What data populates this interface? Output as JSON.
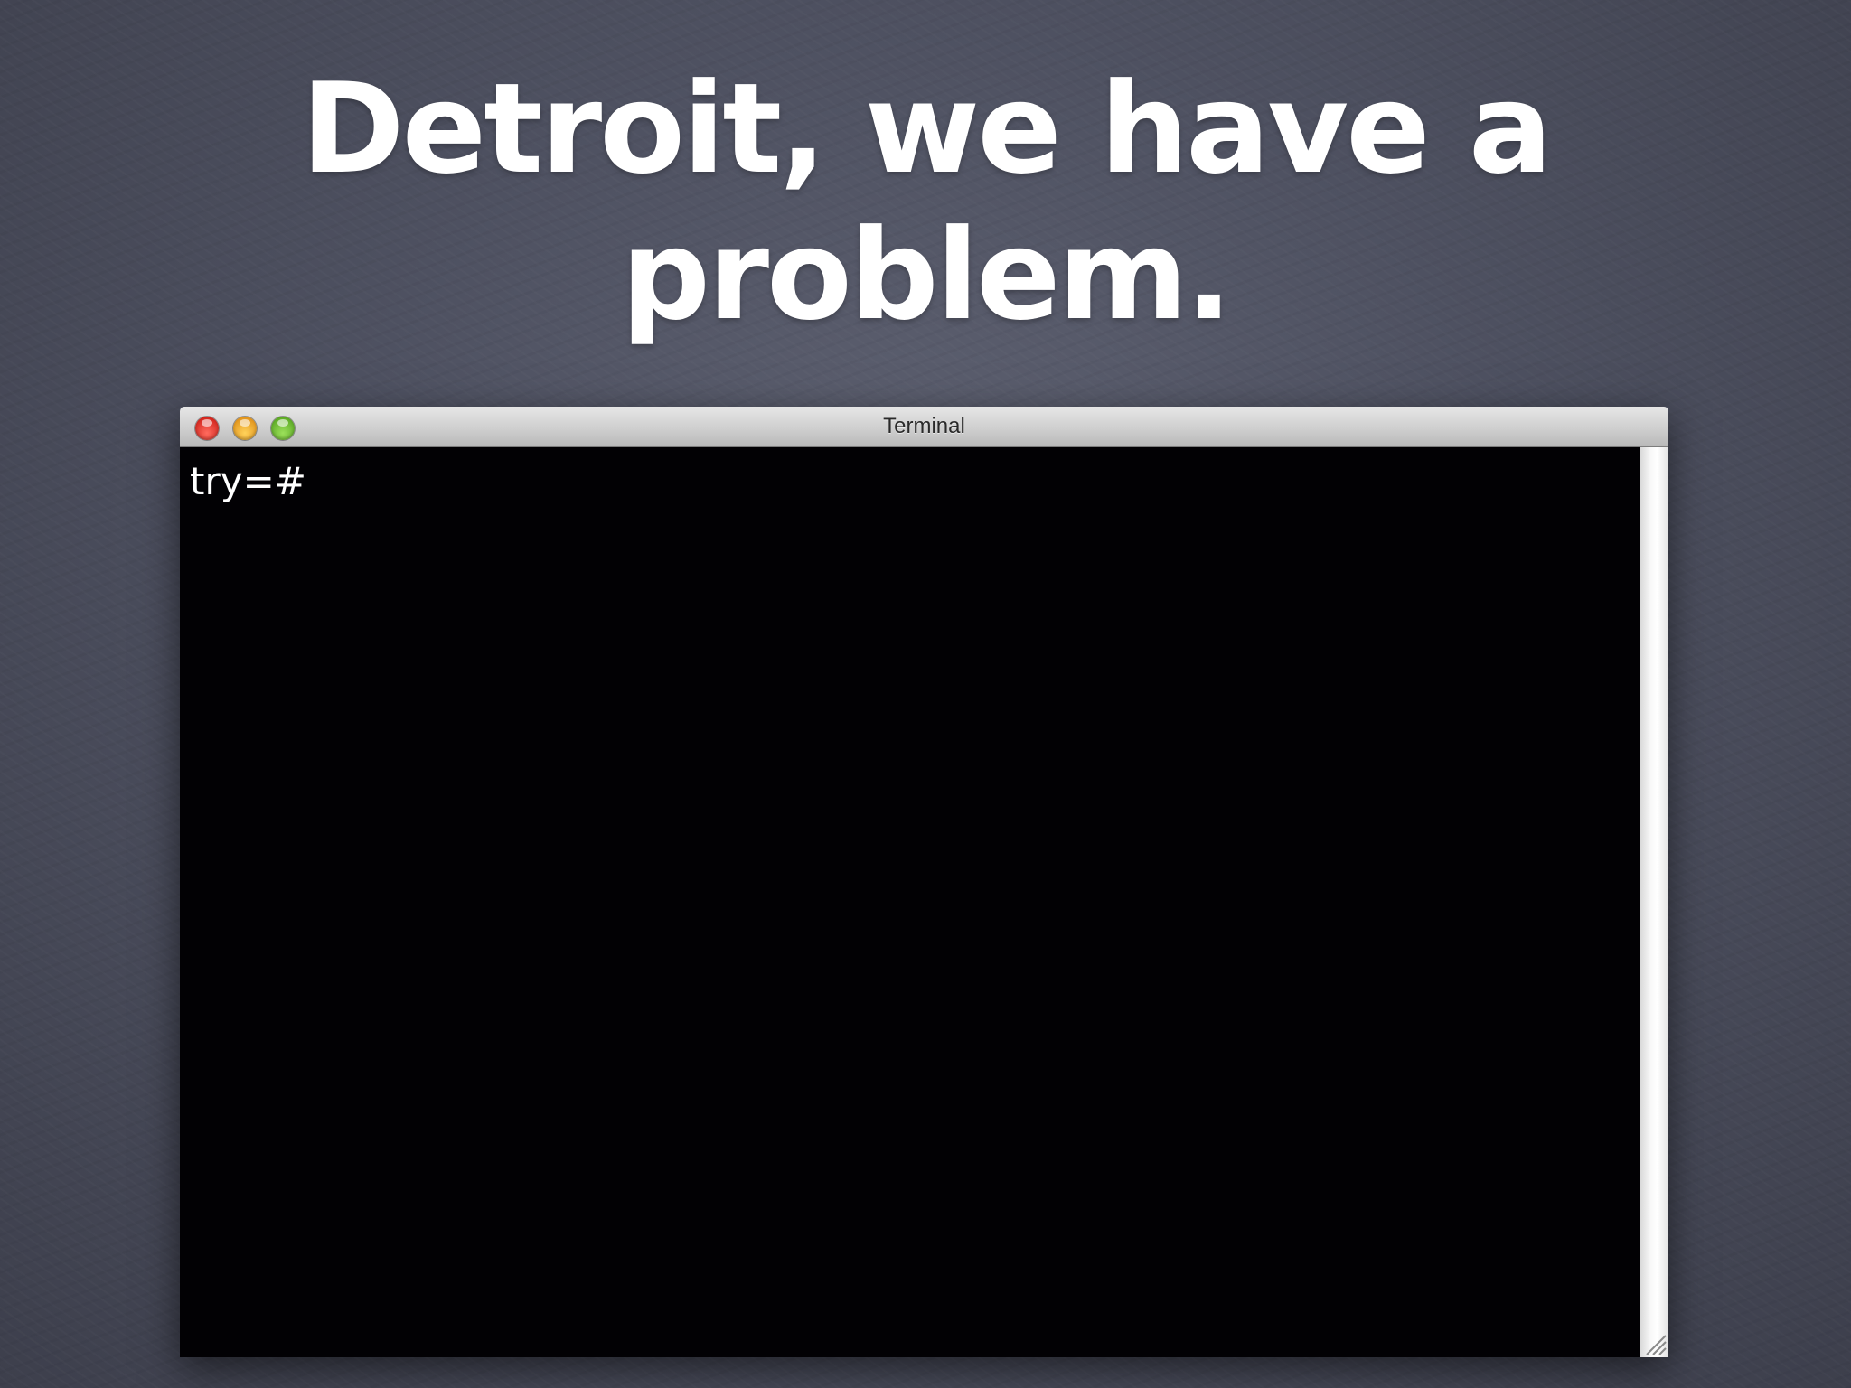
{
  "slide": {
    "title_line_1": "Detroit, we have a",
    "title_line_2": "problem."
  },
  "window": {
    "title": "Terminal",
    "controls": {
      "close": "close-icon",
      "minimize": "minimize-icon",
      "zoom": "zoom-icon"
    },
    "colors": {
      "close": "#e0271d",
      "minimize": "#f2a62b",
      "zoom": "#6cbf2e",
      "terminal_background": "#020104",
      "terminal_text": "#ffffff"
    }
  },
  "terminal": {
    "prompt": "try=#"
  }
}
